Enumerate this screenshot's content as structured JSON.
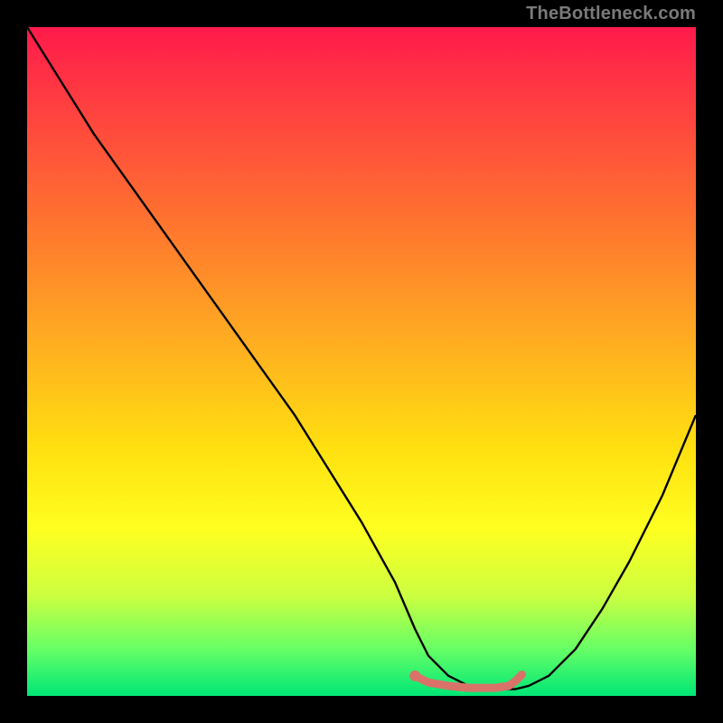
{
  "watermark": "TheBottleneck.com",
  "chart_data": {
    "type": "line",
    "title": "",
    "xlabel": "",
    "ylabel": "",
    "xlim": [
      0,
      100
    ],
    "ylim": [
      0,
      100
    ],
    "series": [
      {
        "name": "bottleneck-curve",
        "x": [
          0,
          5,
          10,
          15,
          20,
          25,
          30,
          35,
          40,
          45,
          50,
          55,
          58,
          60,
          63,
          66,
          70,
          73,
          75,
          78,
          82,
          86,
          90,
          95,
          100
        ],
        "y": [
          100,
          92,
          84,
          77,
          70,
          63,
          56,
          49,
          42,
          34,
          26,
          17,
          10,
          6,
          3,
          1.5,
          1,
          1,
          1.5,
          3,
          7,
          13,
          20,
          30,
          42
        ],
        "color": "#000000",
        "stroke_width": 2.4
      },
      {
        "name": "highlight-segment",
        "x": [
          58,
          60,
          63,
          66,
          70,
          72,
          73,
          74
        ],
        "y": [
          3,
          2,
          1.5,
          1.2,
          1.2,
          1.5,
          2.2,
          3.2
        ],
        "color": "#d9736a",
        "stroke_width": 9
      }
    ],
    "points": [
      {
        "name": "highlight-start-dot",
        "x": 58,
        "y": 3,
        "r": 6,
        "color": "#d9736a"
      }
    ]
  }
}
